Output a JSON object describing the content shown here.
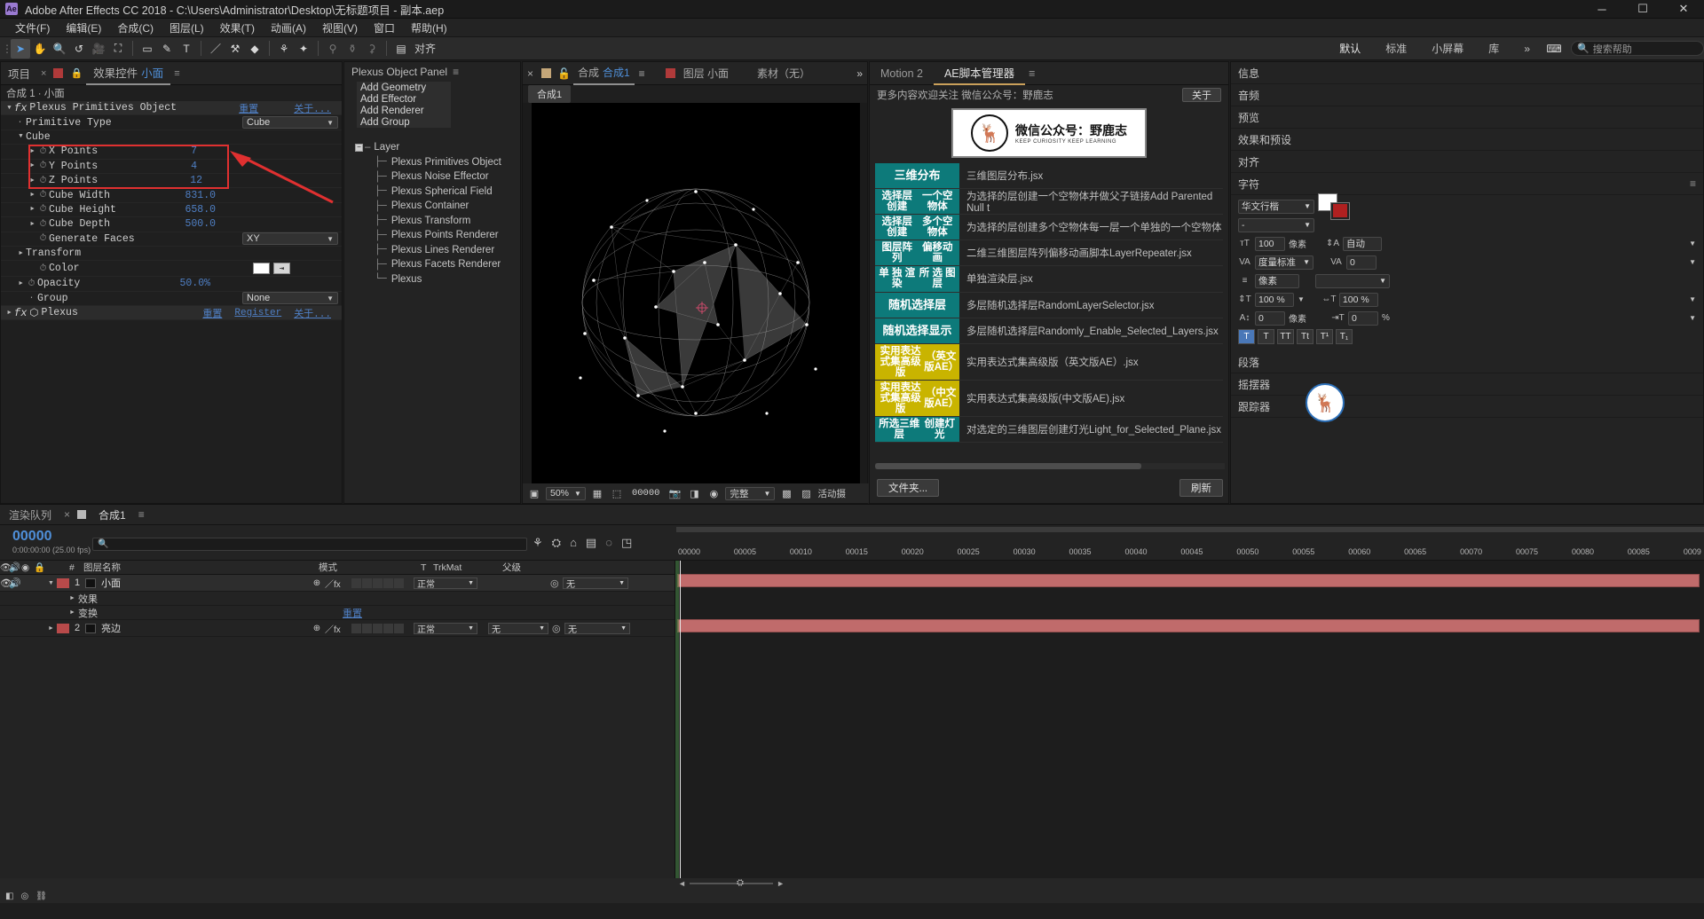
{
  "titlebar": {
    "app_icon": "ae-logo",
    "title": "Adobe After Effects CC 2018 - C:\\Users\\Administrator\\Desktop\\无标题项目 - 副本.aep",
    "minimize": "─",
    "maximize": "☐",
    "close": "✕"
  },
  "menu": [
    "文件(F)",
    "编辑(E)",
    "合成(C)",
    "图层(L)",
    "效果(T)",
    "动画(A)",
    "视图(V)",
    "窗口",
    "帮助(H)"
  ],
  "toolbar": {
    "tools": [
      "cursor-icon",
      "hand-icon",
      "zoom-icon",
      "rotate-icon",
      "camera-icon",
      "pan-behind-icon",
      "shape-icon",
      "pen-icon",
      "text-icon",
      "brush-icon",
      "clone-icon",
      "eraser-icon",
      "roto-brush-icon",
      "puppet-icon"
    ],
    "right_tools": [
      "puppet-pin-icon",
      "puppet-starch-icon",
      "puppet-overlap-icon"
    ],
    "align_label": "对齐",
    "align_icons": [
      "align-left-icon",
      "align-center-icon"
    ],
    "workspaces": [
      "默认",
      "标准",
      "小屏幕",
      "库"
    ],
    "workspace_selected": "默认",
    "workspace_more": "»",
    "keyboard_icon": "keyboard-icon",
    "search_placeholder": "搜索帮助"
  },
  "effect_controls": {
    "tab_project": "项目",
    "close_x": "×",
    "tab_label": "效果控件",
    "tab_layer": "小面",
    "menu_icon": "≡",
    "subtitle": "合成 1 · 小面",
    "effect1": {
      "name": "Plexus Primitives Object",
      "reset": "重置",
      "about": "关于...",
      "rows": [
        {
          "label": "Primitive Type",
          "value": "Cube",
          "type": "select",
          "indent": 1
        },
        {
          "label": "Cube",
          "value": "",
          "type": "group",
          "indent": 1
        },
        {
          "label": "X Points",
          "value": "7",
          "type": "num",
          "indent": 2,
          "highlight": true
        },
        {
          "label": "Y Points",
          "value": "4",
          "type": "num",
          "indent": 2,
          "highlight": true
        },
        {
          "label": "Z Points",
          "value": "12",
          "type": "num",
          "indent": 2,
          "highlight": true
        },
        {
          "label": "Cube Width",
          "value": "831.0",
          "type": "num",
          "indent": 2
        },
        {
          "label": "Cube Height",
          "value": "658.0",
          "type": "num",
          "indent": 2
        },
        {
          "label": "Cube Depth",
          "value": "500.0",
          "type": "num",
          "indent": 2
        },
        {
          "label": "Generate Faces",
          "value": "XY",
          "type": "select",
          "indent": 2
        },
        {
          "label": "Transform",
          "value": "",
          "type": "group",
          "indent": 1
        },
        {
          "label": "Color",
          "value": "",
          "type": "color",
          "indent": 2
        },
        {
          "label": "Opacity",
          "value": "50.0%",
          "type": "num",
          "indent": 2
        },
        {
          "label": "Group",
          "value": "None",
          "type": "select",
          "indent": 2
        }
      ]
    },
    "effect2": {
      "name": "Plexus",
      "reset": "重置",
      "register": "Register",
      "about": "关于..."
    }
  },
  "plexus_panel": {
    "title": "Plexus Object Panel",
    "menu_icon": "≡",
    "buttons": [
      "Add Geometry",
      "Add Effector",
      "Add Renderer",
      "Add Group"
    ],
    "tree_root": "Layer",
    "tree_items": [
      "Plexus Primitives Object",
      "Plexus Noise Effector",
      "Plexus Spherical Field",
      "Plexus Container",
      "Plexus Transform",
      "Plexus Points Renderer",
      "Plexus Lines Renderer",
      "Plexus Facets Renderer",
      "Plexus"
    ]
  },
  "composition": {
    "close_x": "×",
    "lock_icon": "lock-icon",
    "tab_prefix": "合成",
    "tab_name": "合成1",
    "menu_icon": "≡",
    "tab2_label": "图层 小面",
    "tab3_label": "素材（无）",
    "more_icon": "»",
    "breadcrumb": "合成1",
    "zoom_level": "50%",
    "timecode": "00000",
    "quality": "完整",
    "active_camera": "活动摄",
    "bottom_icons": [
      "fit-icon",
      "camera-snapshot-icon",
      "show-snapshot-icon",
      "channel-icon",
      "transparency-grid-icon",
      "region-of-interest-icon",
      "toggle-mask-icon",
      "timecode-icon",
      "resolution-icon"
    ]
  },
  "script_manager": {
    "tabs": [
      "Motion 2",
      "AE脚本管理器"
    ],
    "tab_selected": "AE脚本管理器",
    "menu_icon": "≡",
    "notice": "更多内容欢迎关注 微信公众号：野鹿志",
    "about_button": "关于",
    "logo_title": "微信公众号：野鹿志",
    "logo_sub": "KEEP CURIOSITY KEEP LEARNING",
    "logo_icon": "deer-icon",
    "scripts": [
      {
        "btn": "三维分布",
        "color": "#0d7a7a",
        "desc": "三维图层分布.jsx"
      },
      {
        "btn": "选择层创建\n一个空物体",
        "color": "#0d7a7a",
        "desc": "为选择的层创建一个空物体并做父子链接Add Parented Null t"
      },
      {
        "btn": "选择层创建\n多个空物体",
        "color": "#0d7a7a",
        "desc": "为选择的层创建多个空物体每一层一个单独的一个空物体"
      },
      {
        "btn": "图层阵列\n偏移动画",
        "color": "#0d7a7a",
        "desc": "二维三维图层阵列偏移动画脚本LayerRepeater.jsx"
      },
      {
        "btn": "单 独 渲 染\n所 选 图 层",
        "color": "#0d7a7a",
        "desc": "单独渲染层.jsx"
      },
      {
        "btn": "随机选择层",
        "color": "#0d7a7a",
        "desc": "多层随机选择层RandomLayerSelector.jsx"
      },
      {
        "btn": "随机选择显示",
        "color": "#0d7a7a",
        "desc": "多层随机选择层Randomly_Enable_Selected_Layers.jsx"
      },
      {
        "btn": "实用表达式集高级版\n（英文版AE）",
        "color": "#c9b400",
        "desc": "实用表达式集高级版（英文版AE）.jsx"
      },
      {
        "btn": "实用表达式集高级版\n（中文版AE）",
        "color": "#c9b400",
        "desc": "实用表达式集高级版(中文版AE).jsx"
      },
      {
        "btn": "所选三维层\n创建灯光",
        "color": "#0d7a7a",
        "desc": "对选定的三维图层创建灯光Light_for_Selected_Plane.jsx"
      }
    ],
    "folder_button": "文件夹...",
    "refresh_button": "刷新"
  },
  "right_dock": {
    "sections": [
      "信息",
      "音频",
      "预览",
      "效果和预设",
      "对齐",
      "字符",
      "段落",
      "摇摆器",
      "跟踪器"
    ],
    "character": {
      "font_family": "华文行楷",
      "font_style": "-",
      "font_size_label": "字体大小",
      "size_value": "100",
      "size_unit": "像素",
      "leading_label": "自动",
      "kerning_label": "度量标准",
      "kerning_value": "0",
      "tracking_value": "0",
      "vscale": "100 %",
      "hscale": "100 %",
      "baseline_value": "0",
      "baseline_unit": "像素",
      "tsume_value": "0",
      "tsume_unit": "%",
      "style_buttons": [
        "T",
        "T",
        "TT",
        "Tt",
        "T¹",
        "T₁"
      ],
      "fill_label": "fill-swatch",
      "stroke_label": "stroke-swatch"
    },
    "badge_icon": "deer-badge-icon"
  },
  "timeline": {
    "tabs": [
      "渲染队列",
      "合成1"
    ],
    "tab_selected": "合成1",
    "close_x": "×",
    "menu_icon": "≡",
    "timecode": "00000",
    "timecode_sub": "0:00:00:00 (25.00 fps)",
    "search_placeholder": "",
    "search_icon": "search-icon",
    "toolbar_icons": [
      "composition-mini-flowchart-icon",
      "draft-3d-icon",
      "hide-shy-icon",
      "frame-blending-icon",
      "motion-blur-icon",
      "graph-editor-icon"
    ],
    "columns": [
      "#",
      "图层名称",
      "模式",
      "T",
      "TrkMat",
      "父级"
    ],
    "col_toggles": [
      "video-icon",
      "audio-icon",
      "solo-icon",
      "lock-icon"
    ],
    "ruler_ticks": [
      "00000",
      "00005",
      "00010",
      "00015",
      "00020",
      "00025",
      "00030",
      "00035",
      "00040",
      "00045",
      "00050",
      "00055",
      "00060",
      "00065",
      "00070",
      "00075",
      "00080",
      "00085",
      "0009"
    ],
    "layers": [
      {
        "index": "1",
        "name": "小面",
        "mode": "正常",
        "trkmat": "",
        "parent": "无",
        "color": "#b84a4a",
        "switches": "中/fx"
      },
      {
        "index": "2",
        "name": "亮边",
        "mode": "正常",
        "trkmat": "",
        "parent": "无",
        "color": "#b84a4a",
        "switches": "中/fx"
      }
    ],
    "layer1_props": [
      {
        "label": "效果",
        "reset": ""
      },
      {
        "label": "变换",
        "reset": "重置"
      }
    ],
    "footer_icons": [
      "toggle-switches-icon",
      "frame-render-icon",
      "comp-button-icon"
    ],
    "zoom_slider": "zoom-slider"
  }
}
